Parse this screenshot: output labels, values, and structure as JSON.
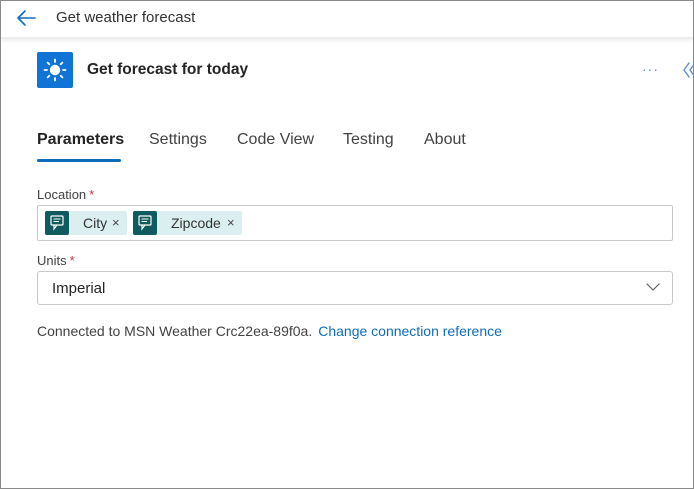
{
  "header": {
    "title": "Get weather forecast",
    "back_icon": "arrow-left-icon"
  },
  "action": {
    "title": "Get forecast for today",
    "icon": "sun-icon",
    "icon_bg": "#0f74d6",
    "more_label": "···",
    "collapse_icon": "double-chevron-left-icon"
  },
  "tabs": [
    {
      "label": "Parameters",
      "active": true
    },
    {
      "label": "Settings",
      "active": false
    },
    {
      "label": "Code View",
      "active": false
    },
    {
      "label": "Testing",
      "active": false
    },
    {
      "label": "About",
      "active": false
    }
  ],
  "location": {
    "label": "Location",
    "required_mark": "*",
    "tokens": [
      {
        "label": "City",
        "remove": "×",
        "icon": "dynamic-content-icon"
      },
      {
        "label": "Zipcode",
        "remove": "×",
        "icon": "dynamic-content-icon"
      }
    ]
  },
  "units": {
    "label": "Units",
    "required_mark": "*",
    "value": "Imperial",
    "chevron": "chevron-down-icon"
  },
  "connection": {
    "text": "Connected to MSN Weather Crc22ea-89f0a.",
    "link_text": "Change connection reference"
  },
  "colors": {
    "accent": "#0f6cbd",
    "token_bg": "#dceff0",
    "token_icon_bg": "#0e5a5e",
    "required": "#c4314b"
  }
}
